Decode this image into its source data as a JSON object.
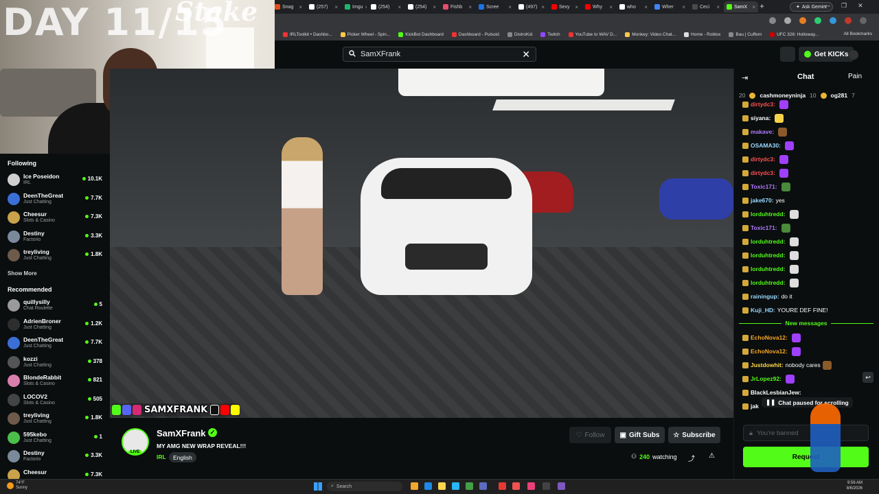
{
  "browser": {
    "tabs": [
      {
        "label": "Snag",
        "color": "#e24e1b"
      },
      {
        "label": "(257)",
        "color": "#ffffff"
      },
      {
        "label": "Imgu",
        "color": "#1bb76e"
      },
      {
        "label": "(254)",
        "color": "#ffffff"
      },
      {
        "label": "(254)",
        "color": "#ffffff"
      },
      {
        "label": "Fishb",
        "color": "#e44d6c"
      },
      {
        "label": "Scree",
        "color": "#1a73e8"
      },
      {
        "label": "(497)",
        "color": "#ffffff"
      },
      {
        "label": "Sexy",
        "color": "#ff0000"
      },
      {
        "label": "Why",
        "color": "#ff0000"
      },
      {
        "label": "who",
        "color": "#ffffff"
      },
      {
        "label": "Wher",
        "color": "#4285f4"
      },
      {
        "label": "Ceci",
        "color": "#4a4a4a"
      },
      {
        "label": "SamX",
        "color": "#53fc18",
        "active": true
      }
    ],
    "new_tab": "+",
    "ask_gemini": "Ask Gemini",
    "window_controls": [
      "—",
      "❐",
      "✕"
    ],
    "bookmarks": [
      {
        "label": "IRLToolkit • Dashbo...",
        "color": "#e33"
      },
      {
        "label": "Picker Wheel - Spin...",
        "color": "#f7c948"
      },
      {
        "label": "KickBot Dashboard",
        "color": "#53fc18"
      },
      {
        "label": "Dashboard - Pulsoid",
        "color": "#e33"
      },
      {
        "label": "DistroKid",
        "color": "#888"
      },
      {
        "label": "Twitch",
        "color": "#9146ff"
      },
      {
        "label": "YouTube to WAV D...",
        "color": "#e33"
      },
      {
        "label": "Monkey: Video Chat...",
        "color": "#f7c948"
      },
      {
        "label": "Home - Roblox",
        "color": "#ddd"
      },
      {
        "label": "Bau | Cuffem",
        "color": "#888"
      },
      {
        "label": "UFC 326: Holloway...",
        "color": "#c00"
      }
    ],
    "all_bookmarks": "All Bookmarks"
  },
  "header": {
    "search_value": "SamXFrank",
    "search_clear": "✕",
    "get_kicks": "Get KICKs"
  },
  "webcam_overlay": {
    "day_label": "DAY 11/15",
    "stake_logo": "Stake"
  },
  "sidebar": {
    "following_heading": "Following",
    "following": [
      {
        "name": "Ice Poseidon",
        "category": "IRL",
        "viewers": "10.1K",
        "avatar": "#cfcfcf"
      },
      {
        "name": "DeenTheGreat",
        "category": "Just Chatting",
        "viewers": "7.7K",
        "avatar": "#3b6fd8"
      },
      {
        "name": "Cheesur",
        "category": "Slots & Casino",
        "viewers": "7.3K",
        "avatar": "#c9a24a"
      },
      {
        "name": "Destiny",
        "category": "Factorio",
        "viewers": "3.3K",
        "avatar": "#7a8a9a"
      },
      {
        "name": "treyliving",
        "category": "Just Chatting",
        "viewers": "1.8K",
        "avatar": "#6d5a4a"
      }
    ],
    "show_more": "Show More",
    "recommended_heading": "Recommended",
    "recommended": [
      {
        "name": "quillysilly",
        "category": "Chat Roulette",
        "viewers": "5",
        "avatar": "#9a9a9a"
      },
      {
        "name": "AdrienBroner",
        "category": "Just Chatting",
        "viewers": "1.2K",
        "avatar": "#2e2e2e"
      },
      {
        "name": "DeenTheGreat",
        "category": "Just Chatting",
        "viewers": "7.7K",
        "avatar": "#3b6fd8"
      },
      {
        "name": "kozzi",
        "category": "Just Chatting",
        "viewers": "378",
        "avatar": "#555"
      },
      {
        "name": "BlondeRabbit",
        "category": "Slots & Casino",
        "viewers": "821",
        "avatar": "#d97fb0"
      },
      {
        "name": "LOCOV2",
        "category": "Slots & Casino",
        "viewers": "505",
        "avatar": "#444"
      },
      {
        "name": "treyliving",
        "category": "Just Chatting",
        "viewers": "1.8K",
        "avatar": "#6d5a4a"
      },
      {
        "name": "595kebo",
        "category": "Just Chatting",
        "viewers": "1",
        "avatar": "#4bbf4b"
      },
      {
        "name": "Destiny",
        "category": "Factorio",
        "viewers": "3.3K",
        "avatar": "#7a8a9a"
      },
      {
        "name": "Cheesur",
        "category": "",
        "viewers": "7.3K",
        "avatar": "#c9a24a"
      }
    ]
  },
  "video": {
    "streamer_tag": "SAMXFRANK"
  },
  "channel": {
    "name": "SamXFrank",
    "live_badge": "LIVE",
    "title": "MY AMG NEW WRAP REVEAL!!!",
    "category": "IRL",
    "language": "English",
    "follow": "Follow",
    "gift_subs": "Gift Subs",
    "subscribe": "Subscribe",
    "viewers": "240",
    "watching_label": "watching"
  },
  "chat": {
    "title": "Chat",
    "extra_label": "Pain",
    "leaderboard": [
      {
        "rank": "20",
        "name": "cashmoneyninja",
        "count": "10"
      },
      {
        "rank": "",
        "name": "og281",
        "count": "7"
      }
    ],
    "messages": [
      {
        "user": "dirtydc3:",
        "color": "#ff4f4f",
        "text": "",
        "emote": "#a040ff"
      },
      {
        "user": "siyana:",
        "color": "#ffffff",
        "text": "",
        "emote": "#f5d24a"
      },
      {
        "user": "makave:",
        "color": "#b07bff",
        "text": "",
        "emote": "#8b5a2b"
      },
      {
        "user": "OSAMA30:",
        "color": "#9ad9ff",
        "text": "",
        "emote": "#a040ff"
      },
      {
        "user": "dirtydc3:",
        "color": "#ff4f4f",
        "text": "",
        "emote": "#a040ff"
      },
      {
        "user": "dirtydc3:",
        "color": "#ff4f4f",
        "text": "",
        "emote": "#a040ff"
      },
      {
        "user": "Toxic171:",
        "color": "#b07bff",
        "text": "",
        "emote": "#4a8a3a"
      },
      {
        "user": "jake670:",
        "color": "#9ad9ff",
        "text": "yes",
        "emote": ""
      },
      {
        "user": "lorduhtredd:",
        "color": "#53fc18",
        "text": "",
        "emote": "#ddd"
      },
      {
        "user": "Toxic171:",
        "color": "#b07bff",
        "text": "",
        "emote": "#4a8a3a"
      },
      {
        "user": "lorduhtredd:",
        "color": "#53fc18",
        "text": "",
        "emote": "#ddd"
      },
      {
        "user": "lorduhtredd:",
        "color": "#53fc18",
        "text": "",
        "emote": "#ddd"
      },
      {
        "user": "lorduhtredd:",
        "color": "#53fc18",
        "text": "",
        "emote": "#ddd"
      },
      {
        "user": "lorduhtredd:",
        "color": "#53fc18",
        "text": "",
        "emote": "#ddd"
      },
      {
        "user": "rainingup:",
        "color": "#9ad9ff",
        "text": "do it",
        "emote": ""
      },
      {
        "user": "Kuji_HD:",
        "color": "#9ad9ff",
        "text": "YOURE DEF FINE!",
        "emote": ""
      }
    ],
    "new_messages_label": "New messages",
    "new_messages": [
      {
        "user": "EchoNova12:",
        "color": "#f5a623",
        "text": "",
        "emote": "#a040ff"
      },
      {
        "user": "EchoNova12:",
        "color": "#f5a623",
        "text": "",
        "emote": "#a040ff"
      },
      {
        "user": "Justdowhit:",
        "color": "#ffd84a",
        "text": "nobody cares",
        "emote": "#8b5a2b"
      },
      {
        "user": "JrLopez92:",
        "color": "#53fc18",
        "text": "",
        "emote": "#a040ff"
      },
      {
        "user": "BlackLesbianJew:",
        "color": "#ffffff",
        "text": "",
        "emote": ""
      },
      {
        "user": "jak",
        "color": "#ffffff",
        "text": "",
        "emote": ""
      }
    ],
    "paused_label": "Chat paused for scrolling",
    "input_placeholder": "You're banned",
    "request_button": "Request"
  },
  "taskbar": {
    "weather_temp": "74°F",
    "weather_desc": "Sunny",
    "search": "Search",
    "time": "9:56 AM",
    "date": "8/6/2026"
  }
}
